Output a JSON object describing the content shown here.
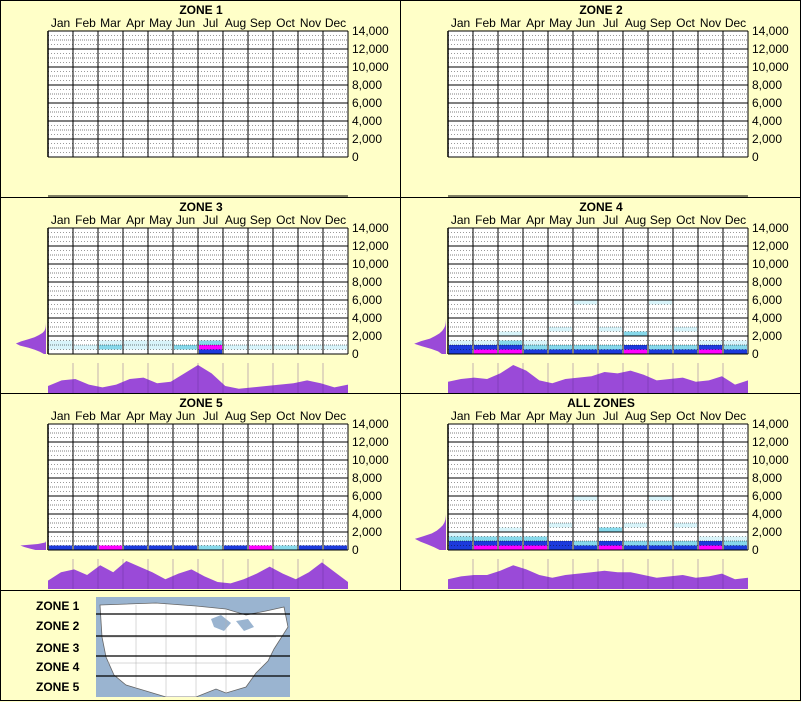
{
  "months": [
    "Jan",
    "Feb",
    "Mar",
    "Apr",
    "May",
    "Jun",
    "Jul",
    "Aug",
    "Sep",
    "Oct",
    "Nov",
    "Dec"
  ],
  "y_ticks": [
    "14,000",
    "12,000",
    "10,000",
    "8,000",
    "6,000",
    "4,000",
    "2,000",
    "0"
  ],
  "colors": {
    "background": "#ffffc8",
    "profile_fill": "#9a4ad8",
    "heat_light": "#d8f4fa",
    "heat_mid": "#86d8ea",
    "heat_blue": "#1c3adc",
    "heat_magenta": "#ff00ff"
  },
  "chart_data": [
    {
      "type": "heatmap",
      "title": "ZONE 1",
      "categories": [
        "Jan",
        "Feb",
        "Mar",
        "Apr",
        "May",
        "Jun",
        "Jul",
        "Aug",
        "Sep",
        "Oct",
        "Nov",
        "Dec"
      ],
      "ylim": [
        0,
        14000
      ],
      "elevation_range": [
        0,
        0
      ],
      "season_profile": [],
      "elevation_profile": []
    },
    {
      "type": "heatmap",
      "title": "ZONE 2",
      "categories": [
        "Jan",
        "Feb",
        "Mar",
        "Apr",
        "May",
        "Jun",
        "Jul",
        "Aug",
        "Sep",
        "Oct",
        "Nov",
        "Dec"
      ],
      "ylim": [
        0,
        14000
      ],
      "elevation_range": [
        0,
        0
      ],
      "season_profile": [],
      "elevation_profile": []
    },
    {
      "type": "heatmap",
      "title": "ZONE 3",
      "categories": [
        "Jan",
        "Feb",
        "Mar",
        "Apr",
        "May",
        "Jun",
        "Jul",
        "Aug",
        "Sep",
        "Oct",
        "Nov",
        "Dec"
      ],
      "ylim": [
        0,
        14000
      ],
      "elevation_range": [
        0,
        3500
      ],
      "season_profile": [
        0.25,
        0.45,
        0.5,
        0.3,
        0.2,
        0.3,
        0.5,
        0.55,
        0.35,
        0.4,
        0.7,
        1.0,
        0.7,
        0.25,
        0.15,
        0.2,
        0.25,
        0.3,
        0.35,
        0.45,
        0.35,
        0.2,
        0.3
      ],
      "elevation_profile": [
        0.05,
        0.15,
        0.3,
        0.5,
        0.8,
        1.0,
        0.9,
        0.7,
        0.5,
        0.35,
        0.2,
        0.1,
        0.05,
        0.03,
        0.01,
        0.0
      ],
      "cells": [
        {
          "month": 0,
          "elev": 500,
          "level": 1
        },
        {
          "month": 0,
          "elev": 1000,
          "level": 1
        },
        {
          "month": 1,
          "elev": 500,
          "level": 1
        },
        {
          "month": 2,
          "elev": 500,
          "level": 2
        },
        {
          "month": 2,
          "elev": 1000,
          "level": 1
        },
        {
          "month": 3,
          "elev": 500,
          "level": 1
        },
        {
          "month": 3,
          "elev": 1000,
          "level": 1
        },
        {
          "month": 4,
          "elev": 500,
          "level": 1
        },
        {
          "month": 4,
          "elev": 1000,
          "level": 1
        },
        {
          "month": 5,
          "elev": 500,
          "level": 2
        },
        {
          "month": 6,
          "elev": 0,
          "level": 3
        },
        {
          "month": 6,
          "elev": 500,
          "level": 4
        },
        {
          "month": 6,
          "elev": 1000,
          "level": 2
        },
        {
          "month": 7,
          "elev": 500,
          "level": 1
        },
        {
          "month": 8,
          "elev": 500,
          "level": 1
        },
        {
          "month": 9,
          "elev": 500,
          "level": 1
        },
        {
          "month": 10,
          "elev": 500,
          "level": 1
        },
        {
          "month": 11,
          "elev": 500,
          "level": 1
        }
      ]
    },
    {
      "type": "heatmap",
      "title": "ZONE 4",
      "categories": [
        "Jan",
        "Feb",
        "Mar",
        "Apr",
        "May",
        "Jun",
        "Jul",
        "Aug",
        "Sep",
        "Oct",
        "Nov",
        "Dec"
      ],
      "ylim": [
        0,
        14000
      ],
      "elevation_range": [
        0,
        4000
      ],
      "season_profile": [
        0.4,
        0.5,
        0.55,
        0.5,
        0.7,
        1.0,
        0.8,
        0.45,
        0.35,
        0.5,
        0.55,
        0.6,
        0.75,
        0.7,
        0.8,
        0.65,
        0.45,
        0.5,
        0.55,
        0.4,
        0.45,
        0.6,
        0.3,
        0.45
      ],
      "elevation_profile": [
        0.1,
        0.2,
        0.4,
        0.7,
        1.0,
        0.85,
        0.6,
        0.45,
        0.3,
        0.2,
        0.12,
        0.06,
        0.03,
        0.01,
        0.0
      ],
      "cells": [
        {
          "month": 0,
          "elev": 0,
          "level": 3
        },
        {
          "month": 0,
          "elev": 500,
          "level": 3
        },
        {
          "month": 0,
          "elev": 1000,
          "level": 1
        },
        {
          "month": 1,
          "elev": 0,
          "level": 4
        },
        {
          "month": 1,
          "elev": 500,
          "level": 3
        },
        {
          "month": 1,
          "elev": 1000,
          "level": 1
        },
        {
          "month": 2,
          "elev": 0,
          "level": 4
        },
        {
          "month": 2,
          "elev": 500,
          "level": 3
        },
        {
          "month": 2,
          "elev": 1000,
          "level": 2
        },
        {
          "month": 2,
          "elev": 2000,
          "level": 1
        },
        {
          "month": 3,
          "elev": 0,
          "level": 3
        },
        {
          "month": 3,
          "elev": 500,
          "level": 2
        },
        {
          "month": 3,
          "elev": 1000,
          "level": 1
        },
        {
          "month": 4,
          "elev": 0,
          "level": 3
        },
        {
          "month": 4,
          "elev": 500,
          "level": 2
        },
        {
          "month": 4,
          "elev": 2500,
          "level": 1
        },
        {
          "month": 5,
          "elev": 0,
          "level": 3
        },
        {
          "month": 5,
          "elev": 500,
          "level": 2
        },
        {
          "month": 5,
          "elev": 5500,
          "level": 1
        },
        {
          "month": 6,
          "elev": 0,
          "level": 3
        },
        {
          "month": 6,
          "elev": 500,
          "level": 2
        },
        {
          "month": 6,
          "elev": 2500,
          "level": 1
        },
        {
          "month": 7,
          "elev": 0,
          "level": 4
        },
        {
          "month": 7,
          "elev": 500,
          "level": 3
        },
        {
          "month": 7,
          "elev": 2000,
          "level": 2
        },
        {
          "month": 8,
          "elev": 0,
          "level": 3
        },
        {
          "month": 8,
          "elev": 500,
          "level": 2
        },
        {
          "month": 8,
          "elev": 5500,
          "level": 1
        },
        {
          "month": 9,
          "elev": 0,
          "level": 3
        },
        {
          "month": 9,
          "elev": 500,
          "level": 2
        },
        {
          "month": 9,
          "elev": 2500,
          "level": 1
        },
        {
          "month": 10,
          "elev": 0,
          "level": 4
        },
        {
          "month": 10,
          "elev": 500,
          "level": 3
        },
        {
          "month": 10,
          "elev": 1000,
          "level": 1
        },
        {
          "month": 11,
          "elev": 0,
          "level": 3
        },
        {
          "month": 11,
          "elev": 500,
          "level": 2
        },
        {
          "month": 11,
          "elev": 1000,
          "level": 1
        }
      ]
    },
    {
      "type": "heatmap",
      "title": "ZONE 5",
      "categories": [
        "Jan",
        "Feb",
        "Mar",
        "Apr",
        "May",
        "Jun",
        "Jul",
        "Aug",
        "Sep",
        "Oct",
        "Nov",
        "Dec"
      ],
      "ylim": [
        0,
        14000
      ],
      "elevation_range": [
        0,
        1000
      ],
      "season_profile": [
        0.3,
        0.6,
        0.7,
        0.5,
        0.85,
        0.6,
        1.0,
        0.8,
        0.6,
        0.35,
        0.55,
        0.7,
        0.45,
        0.25,
        0.2,
        0.35,
        0.55,
        0.8,
        0.55,
        0.35,
        0.6,
        0.95,
        0.6,
        0.25
      ],
      "elevation_profile": [
        0.25,
        0.45,
        0.7,
        1.0,
        0.4,
        0.05,
        0.0
      ],
      "cells": [
        {
          "month": 0,
          "elev": 0,
          "level": 3
        },
        {
          "month": 1,
          "elev": 0,
          "level": 3
        },
        {
          "month": 2,
          "elev": 0,
          "level": 4
        },
        {
          "month": 3,
          "elev": 0,
          "level": 3
        },
        {
          "month": 4,
          "elev": 0,
          "level": 3
        },
        {
          "month": 5,
          "elev": 0,
          "level": 3
        },
        {
          "month": 6,
          "elev": 0,
          "level": 2
        },
        {
          "month": 7,
          "elev": 0,
          "level": 3
        },
        {
          "month": 8,
          "elev": 0,
          "level": 4
        },
        {
          "month": 9,
          "elev": 0,
          "level": 2
        },
        {
          "month": 10,
          "elev": 0,
          "level": 3
        },
        {
          "month": 11,
          "elev": 0,
          "level": 3
        }
      ]
    },
    {
      "type": "heatmap",
      "title": "ALL ZONES",
      "categories": [
        "Jan",
        "Feb",
        "Mar",
        "Apr",
        "May",
        "Jun",
        "Jul",
        "Aug",
        "Sep",
        "Oct",
        "Nov",
        "Dec"
      ],
      "ylim": [
        0,
        14000
      ],
      "elevation_range": [
        0,
        4000
      ],
      "season_profile": [
        0.35,
        0.45,
        0.5,
        0.5,
        0.65,
        0.85,
        0.7,
        0.5,
        0.4,
        0.5,
        0.55,
        0.6,
        0.65,
        0.6,
        0.6,
        0.5,
        0.4,
        0.45,
        0.5,
        0.4,
        0.45,
        0.55,
        0.35,
        0.4
      ],
      "elevation_profile": [
        0.15,
        0.3,
        0.5,
        0.75,
        1.0,
        0.8,
        0.55,
        0.4,
        0.28,
        0.18,
        0.1,
        0.05,
        0.02,
        0.0
      ],
      "cells": [
        {
          "month": 0,
          "elev": 0,
          "level": 3
        },
        {
          "month": 0,
          "elev": 500,
          "level": 3
        },
        {
          "month": 0,
          "elev": 1000,
          "level": 2
        },
        {
          "month": 0,
          "elev": 1500,
          "level": 1
        },
        {
          "month": 1,
          "elev": 0,
          "level": 4
        },
        {
          "month": 1,
          "elev": 500,
          "level": 3
        },
        {
          "month": 1,
          "elev": 1000,
          "level": 2
        },
        {
          "month": 2,
          "elev": 0,
          "level": 4
        },
        {
          "month": 2,
          "elev": 500,
          "level": 3
        },
        {
          "month": 2,
          "elev": 1000,
          "level": 2
        },
        {
          "month": 2,
          "elev": 2000,
          "level": 1
        },
        {
          "month": 3,
          "elev": 0,
          "level": 4
        },
        {
          "month": 3,
          "elev": 500,
          "level": 3
        },
        {
          "month": 3,
          "elev": 1000,
          "level": 2
        },
        {
          "month": 4,
          "elev": 0,
          "level": 3
        },
        {
          "month": 4,
          "elev": 500,
          "level": 3
        },
        {
          "month": 4,
          "elev": 2500,
          "level": 1
        },
        {
          "month": 5,
          "elev": 0,
          "level": 3
        },
        {
          "month": 5,
          "elev": 500,
          "level": 2
        },
        {
          "month": 5,
          "elev": 5500,
          "level": 1
        },
        {
          "month": 6,
          "elev": 0,
          "level": 4
        },
        {
          "month": 6,
          "elev": 500,
          "level": 3
        },
        {
          "month": 6,
          "elev": 2000,
          "level": 2
        },
        {
          "month": 7,
          "elev": 0,
          "level": 3
        },
        {
          "month": 7,
          "elev": 500,
          "level": 2
        },
        {
          "month": 7,
          "elev": 2500,
          "level": 1
        },
        {
          "month": 8,
          "elev": 0,
          "level": 3
        },
        {
          "month": 8,
          "elev": 500,
          "level": 2
        },
        {
          "month": 8,
          "elev": 5500,
          "level": 1
        },
        {
          "month": 9,
          "elev": 0,
          "level": 3
        },
        {
          "month": 9,
          "elev": 500,
          "level": 2
        },
        {
          "month": 9,
          "elev": 2500,
          "level": 1
        },
        {
          "month": 10,
          "elev": 0,
          "level": 4
        },
        {
          "month": 10,
          "elev": 500,
          "level": 3
        },
        {
          "month": 10,
          "elev": 1000,
          "level": 1
        },
        {
          "month": 11,
          "elev": 0,
          "level": 3
        },
        {
          "month": 11,
          "elev": 500,
          "level": 2
        },
        {
          "month": 11,
          "elev": 1000,
          "level": 1
        }
      ]
    }
  ],
  "legend": {
    "zones": [
      "ZONE 1",
      "ZONE 2",
      "ZONE 3",
      "ZONE 4",
      "ZONE 5"
    ]
  }
}
